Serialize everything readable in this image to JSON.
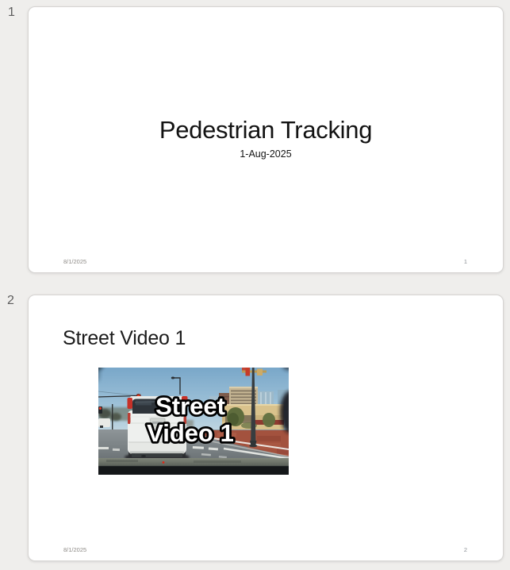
{
  "view": {
    "kind": "presentation-preview",
    "slide_count": 2
  },
  "slides": [
    {
      "thumbnail_index": "1",
      "layout": "title-slide",
      "title": "Pedestrian Tracking",
      "subtitle": "1-Aug-2025",
      "footer_date": "8/1/2025",
      "slide_number": "1"
    },
    {
      "thumbnail_index": "2",
      "layout": "title-and-content",
      "title": "Street Video 1",
      "media": {
        "type": "video-thumbnail",
        "description": "dashcam view of city street with white SUV, buildings and red brick plaza",
        "overlay_line1": "Street",
        "overlay_line2": "Video 1"
      },
      "footer_date": "8/1/2025",
      "slide_number": "2"
    }
  ],
  "colors": {
    "canvas_bg": "#efeeec",
    "slide_bg": "#ffffff",
    "slide_border": "#d6d4d2",
    "title_text": "#121212",
    "muted_footer": "#8f8c88",
    "index_label": "#5d5d5d",
    "overlay_text_fill": "#ffffff",
    "overlay_text_outline": "#000000"
  }
}
